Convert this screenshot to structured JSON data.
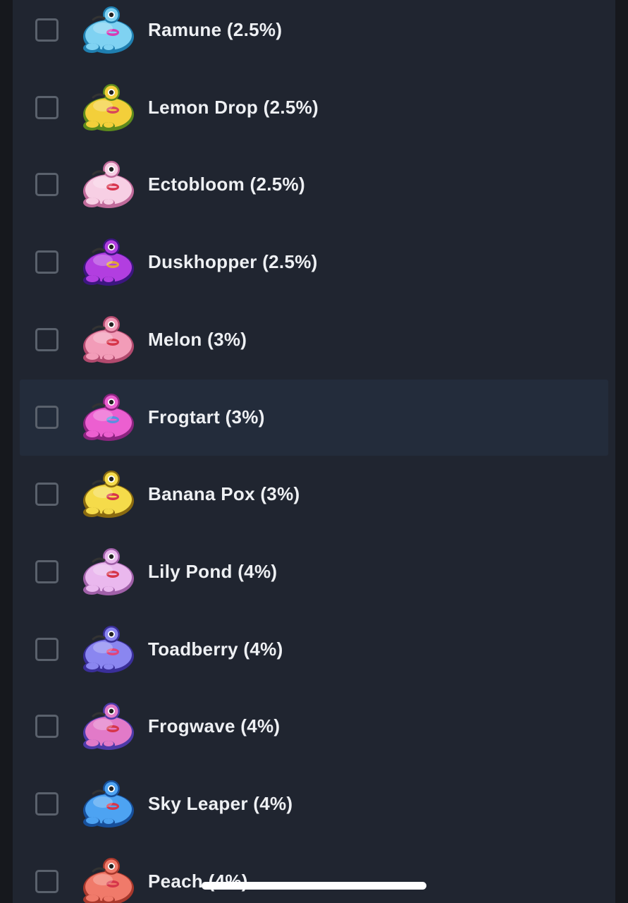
{
  "items": [
    {
      "label": "Ramune (2.5%)",
      "icon": "frog-ramune-icon",
      "color": "#7fd2f2",
      "dark": "#1f7fb0",
      "mouth": "#d63bb5",
      "highlight": false,
      "checked": false
    },
    {
      "label": "Lemon Drop (2.5%)",
      "icon": "frog-lemon-drop-icon",
      "color": "#f3cf3a",
      "dark": "#5d8a1c",
      "mouth": "#d9485a",
      "highlight": false,
      "checked": false
    },
    {
      "label": "Ectobloom (2.5%)",
      "icon": "frog-ectobloom-icon",
      "color": "#f7cfe4",
      "dark": "#c06a9a",
      "mouth": "#d8354d",
      "highlight": false,
      "checked": false
    },
    {
      "label": "Duskhopper (2.5%)",
      "icon": "frog-duskhopper-icon",
      "color": "#b23ee0",
      "dark": "#3d1680",
      "mouth": "#e0a43a",
      "highlight": false,
      "checked": false
    },
    {
      "label": "Melon (3%)",
      "icon": "frog-melon-icon",
      "color": "#f29cb8",
      "dark": "#b24a6e",
      "mouth": "#d6354a",
      "highlight": false,
      "checked": false
    },
    {
      "label": "Frogtart (3%)",
      "icon": "frog-frogtart-icon",
      "color": "#ec5fd0",
      "dark": "#8c2480",
      "mouth": "#5b8fe0",
      "highlight": true,
      "checked": false
    },
    {
      "label": "Banana Pox (3%)",
      "icon": "frog-banana-pox-icon",
      "color": "#f5db4a",
      "dark": "#8a6a10",
      "mouth": "#d6354a",
      "highlight": false,
      "checked": false
    },
    {
      "label": "Lily Pond (4%)",
      "icon": "frog-lily-pond-icon",
      "color": "#eab8ee",
      "dark": "#a060a8",
      "mouth": "#d6354a",
      "highlight": false,
      "checked": false
    },
    {
      "label": "Toadberry (4%)",
      "icon": "frog-toadberry-icon",
      "color": "#8a86f0",
      "dark": "#3a2f9a",
      "mouth": "#e2447a",
      "highlight": false,
      "checked": false
    },
    {
      "label": "Frogwave (4%)",
      "icon": "frog-frogwave-icon",
      "color": "#e27ac8",
      "dark": "#4d3aa8",
      "mouth": "#d6354a",
      "highlight": false,
      "checked": false
    },
    {
      "label": "Sky Leaper (4%)",
      "icon": "frog-sky-leaper-icon",
      "color": "#4da3f2",
      "dark": "#174f9a",
      "mouth": "#d6354a",
      "highlight": false,
      "checked": false
    },
    {
      "label": "Peach (4%)",
      "icon": "frog-peach-icon",
      "color": "#f07a6a",
      "dark": "#a8382c",
      "mouth": "#d6354a",
      "highlight": false,
      "checked": false
    }
  ]
}
